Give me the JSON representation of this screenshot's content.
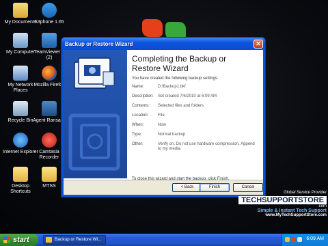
{
  "desktop": {
    "icons": [
      {
        "label": "My Documents",
        "icon": "documents-icon"
      },
      {
        "label": "S3phone 1.65",
        "icon": "skype-icon"
      },
      {
        "label": "My Computer",
        "icon": "computer-icon"
      },
      {
        "label": "TeamViewer 5 (2)",
        "icon": "teamviewer-icon"
      },
      {
        "label": "My Network Places",
        "icon": "network-icon"
      },
      {
        "label": "Mozilla Firefox",
        "icon": "firefox-icon"
      },
      {
        "label": "Recycle Bin",
        "icon": "recycle-bin-icon"
      },
      {
        "label": "Agent Ransack",
        "icon": "agent-icon"
      },
      {
        "label": "Internet Explorer",
        "icon": "internet-explorer-icon"
      },
      {
        "label": "Camtasia Recorder",
        "icon": "camtasia-icon"
      },
      {
        "label": "Desktop Shortcuts",
        "icon": "folder-icon"
      },
      {
        "label": "MTSS",
        "icon": "folder-icon"
      }
    ]
  },
  "window": {
    "title": "Backup or Restore Wizard",
    "close_glyph": "✕",
    "heading_line1": "Completing the Backup or",
    "heading_line2": "Restore Wizard",
    "intro": "You have created the following backup settings:",
    "settings": [
      {
        "key": "Name:",
        "value": "D:\\Backup1.bkf"
      },
      {
        "key": "Description:",
        "value": "Set created 7/6/2010 at 6:09 AM"
      },
      {
        "key": "Contents:",
        "value": "Selected files and folders"
      },
      {
        "key": "Location:",
        "value": "File"
      },
      {
        "key": "When:",
        "value": "Now"
      },
      {
        "key": "Type:",
        "value": "Normal backup"
      },
      {
        "key": "Other:",
        "value": "Verify on. Do not use hardware compression. Append to my media."
      }
    ],
    "finish_note": "To close this wizard and start the backup, click Finish.",
    "buttons": {
      "back": "< Back",
      "finish": "Finish",
      "cancel": "Cancel"
    }
  },
  "watermark": {
    "provider": "Global Service Provider",
    "brand": "TECHSUPPORTSTORE",
    "domain": ".com",
    "tagline": "Simple & Instant Tech Support",
    "url": "www.MyTechSupportStore.com"
  },
  "taskbar": {
    "start_label": "start",
    "task_label": "Backup or Restore Wi...",
    "clock": "6:09 AM"
  },
  "colors": {
    "title_bar": "#0a53d8",
    "side_panel": "#1d469a",
    "taskbar": "#245dd7",
    "start_button": "#318a2c",
    "dialog_bg": "#ffffff"
  }
}
